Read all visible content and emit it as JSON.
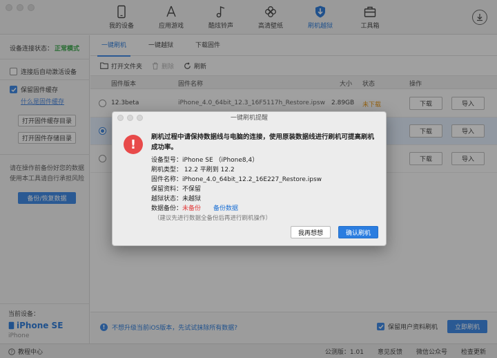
{
  "nav": {
    "items": [
      {
        "label": "我的设备",
        "icon": "phone-icon"
      },
      {
        "label": "应用游戏",
        "icon": "app-store-icon"
      },
      {
        "label": "酷炫铃声",
        "icon": "music-note-icon"
      },
      {
        "label": "高清壁纸",
        "icon": "flower-icon"
      },
      {
        "label": "刷机越狱",
        "icon": "shield-icon"
      },
      {
        "label": "工具箱",
        "icon": "toolbox-icon"
      }
    ],
    "active_index": 4
  },
  "sidebar": {
    "status_label": "设备连接状态：",
    "status_value": "正常模式",
    "auto_activate_label": "连接后自动激活设备",
    "keep_cache_label": "保留固件缓存",
    "what_is_cache_link": "什么是固件缓存",
    "open_cache_dir_button": "打开固件缓存目录",
    "open_store_dir_button": "打开固件存储目录",
    "backup_note": "请在操作前备份好您的数据使用本工具请自行承担风险",
    "backup_button": "备份/恢复数据",
    "current_device_label": "当前设备：",
    "device_name": "iPhone SE",
    "device_sub": "iPhone"
  },
  "tabs": [
    "一键刷机",
    "一键越狱",
    "下载固件"
  ],
  "toolbar": {
    "open_folder": "打开文件夹",
    "delete": "删除",
    "refresh": "刷新"
  },
  "table": {
    "headers": [
      "固件版本",
      "固件名称",
      "大小",
      "状态",
      "操作"
    ],
    "rows": [
      {
        "version": "12.3beta",
        "name": "iPhone_4.0_64bit_12.3_16F5117h_Restore.ipsw",
        "size": "2.89GB",
        "status": "未下载",
        "actions": [
          "下载",
          "导入"
        ]
      },
      {
        "actions": [
          "下载",
          "导入"
        ]
      },
      {
        "actions": [
          "下载",
          "导入"
        ]
      }
    ]
  },
  "bottom": {
    "info_link": "不想升级当前iOS版本，先试试抹除所有数据?",
    "keep_user_data": "保留用户资料刷机",
    "flash_now": "立即刷机"
  },
  "statusbar": {
    "tutorial": "教程中心",
    "version": "公测版：1.01",
    "feedback": "意见反馈",
    "wechat": "微信公众号",
    "check_update": "检查更新"
  },
  "dialog": {
    "title": "一键刷机提醒",
    "heading": "刷机过程中请保持数据线与电脑的连接，使用原装数据线进行刷机可提高刷机成功率。",
    "model_label": "设备型号：",
    "model_value": "iPhone SE  （iPhone8,4）",
    "type_label": "刷机类型：",
    "type_value": " 12.2 平刷到 12.2",
    "firmware_label": "固件名称：",
    "firmware_value": "iPhone_4.0_64bit_12.2_16E227_Restore.ipsw",
    "keep_label": "保留资料：",
    "keep_value": "不保留",
    "jb_label": "越狱状态：",
    "jb_value": "未越狱",
    "backup_label": "数据备份：",
    "backup_value": "未备份",
    "backup_link": "备份数据",
    "hint": "（建议先进行数据全备份后再进行刷机操作）",
    "cancel_button": "我再想想",
    "confirm_button": "确认刷机"
  },
  "colors": {
    "accent": "#2b7de0",
    "ok_green": "#2a9d3c",
    "warn_orange": "#e08a00",
    "alert_red": "#e84a4a"
  }
}
